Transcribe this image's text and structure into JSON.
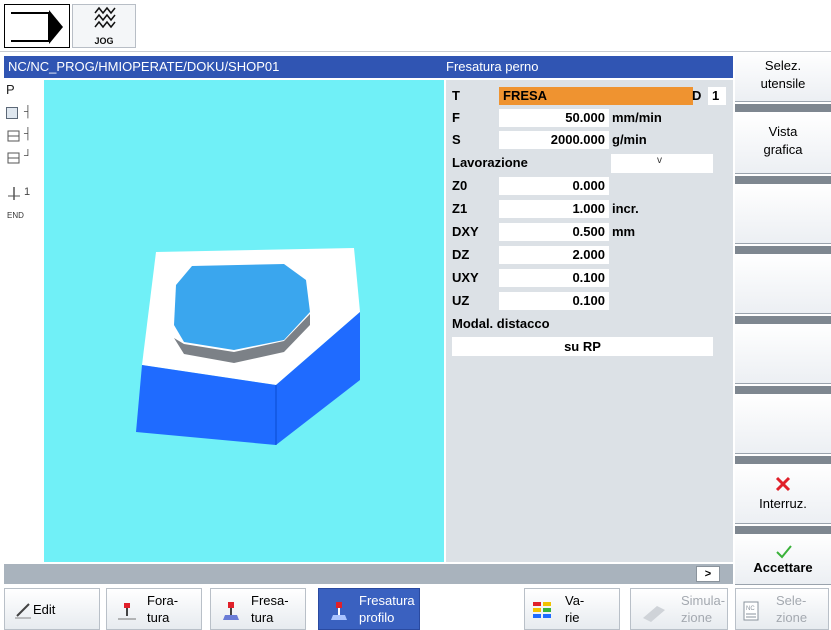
{
  "top": {
    "mode_label": "JOG"
  },
  "header": {
    "path": "NC/NC_PROG/HMIOPERATE/DOKU/SHOP01",
    "title": "Fresatura perno"
  },
  "program_list": {
    "first_item": "P",
    "end_item": "END"
  },
  "params": {
    "tool": {
      "label": "T",
      "value": "FRESA",
      "d_label": "D",
      "d_value": "1"
    },
    "feed": {
      "label": "F",
      "value": "50.000",
      "unit": "mm/min"
    },
    "spindle": {
      "label": "S",
      "value": "2000.000",
      "unit": "g/min"
    },
    "machining": {
      "label": "Lavorazione",
      "value": "",
      "arrow": "v"
    },
    "z0": {
      "label": "Z0",
      "value": "0.000"
    },
    "z1": {
      "label": "Z1",
      "value": "1.000",
      "unit": "incr."
    },
    "dxy": {
      "label": "DXY",
      "value": "0.500",
      "unit": "mm"
    },
    "dz": {
      "label": "DZ",
      "value": "2.000"
    },
    "uxy": {
      "label": "UXY",
      "value": "0.100"
    },
    "uz": {
      "label": "UZ",
      "value": "0.100"
    },
    "retract": {
      "label": "Modal. distacco",
      "value": "su RP"
    }
  },
  "right_softkeys": {
    "select_tool": [
      "Selez.",
      "utensile"
    ],
    "graphic_view": [
      "Vista",
      "grafica"
    ],
    "cancel": "Interruz.",
    "accept": "Accettare"
  },
  "status": {
    "more": ">"
  },
  "bottom_softkeys": {
    "edit": "Edit",
    "drilling": [
      "Fora-",
      "tura"
    ],
    "milling": [
      "Fresa-",
      "tura"
    ],
    "contour_milling": [
      "Fresatura",
      "profilo"
    ],
    "misc": [
      "Va-",
      "rie"
    ],
    "simulation": [
      "Simula-",
      "zione"
    ],
    "selection": [
      "Sele-",
      "zione"
    ]
  },
  "colors": {
    "header_blue": "#3055b3",
    "graphic_bg": "#70f0f7",
    "tool_field": "#ef9330",
    "panel_bg": "#dce1e6",
    "part_blue": "#1f6bff",
    "pin_top": "#3aa6ee",
    "cancel_red": "#e0202a",
    "accept_green": "#3ab23a"
  },
  "icons": {
    "program": "program-arrow-icon",
    "mode": "jog-mode-icon",
    "cancel": "cross-icon",
    "accept": "checkmark-icon"
  }
}
